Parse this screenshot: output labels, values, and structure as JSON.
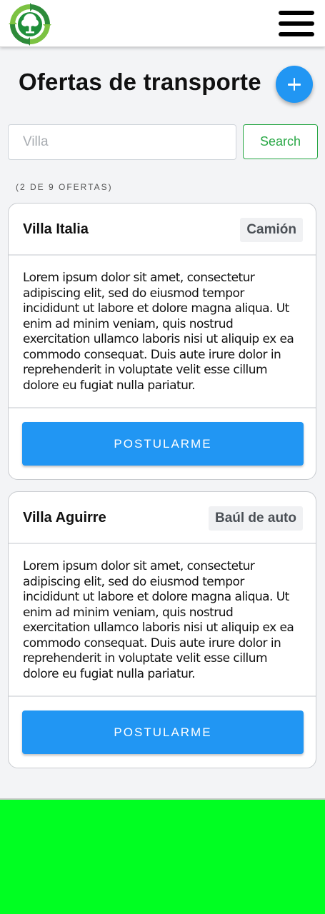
{
  "header": {
    "logo": "recycling-tree-logo",
    "menu_icon": "hamburger-menu-icon"
  },
  "page": {
    "title": "Ofertas de transporte",
    "add_icon": "plus-icon"
  },
  "search": {
    "placeholder": "Villa",
    "value": "",
    "button_label": "Search"
  },
  "results": {
    "count_label": "(2 de 9 ofertas)"
  },
  "offers": [
    {
      "title": "Villa Italia",
      "vehicle": "Camión",
      "description": "Lorem ipsum dolor sit amet, consectetur adipiscing elit, sed do eiusmod tempor incididunt ut labore et dolore magna aliqua. Ut enim ad minim veniam, quis nostrud exercitation ullamco laboris nisi ut aliquip ex ea commodo consequat. Duis aute irure dolor in reprehenderit in voluptate velit esse cillum dolore eu fugiat nulla pariatur.",
      "apply_label": "Postularme"
    },
    {
      "title": "Villa Aguirre",
      "vehicle": "Baúl de auto",
      "description": "Lorem ipsum dolor sit amet, consectetur adipiscing elit, sed do eiusmod tempor incididunt ut labore et dolore magna aliqua. Ut enim ad minim veniam, quis nostrud exercitation ullamco laboris nisi ut aliquip ex ea commodo consequat. Duis aute irure dolor in reprehenderit in voluptate velit esse cillum dolore eu fugiat nulla pariatur.",
      "apply_label": "Postularme"
    }
  ],
  "colors": {
    "primary": "#2196f3",
    "success": "#28a745",
    "footer": "#00ff22",
    "background": "#f3f4f6"
  }
}
